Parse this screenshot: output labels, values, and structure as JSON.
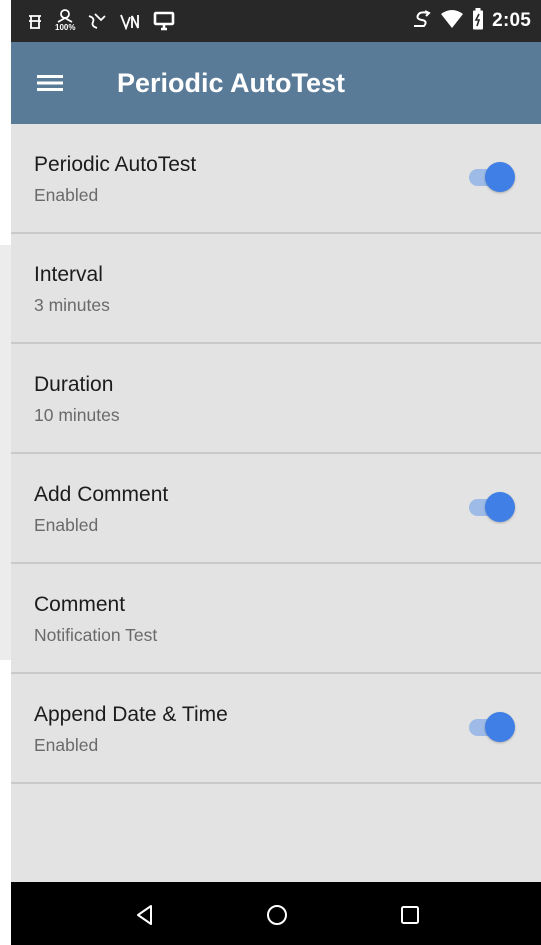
{
  "status_bar": {
    "time": "2:05",
    "icons_left": [
      "network-tool-icon",
      "battery-100-percent-icon",
      "signal-tool-icon",
      "voltage-icon",
      "desktop-icon"
    ],
    "icons_right": [
      "sync-arrow-icon",
      "wifi-icon",
      "battery-icon"
    ],
    "battery_small_label": "100%"
  },
  "app_bar": {
    "title": "Periodic AutoTest",
    "menu_icon": "hamburger-menu-icon",
    "background": "#5a7b98"
  },
  "settings": [
    {
      "title": "Periodic AutoTest",
      "subtitle": "Enabled",
      "toggle": true
    },
    {
      "title": "Interval",
      "subtitle": "3 minutes",
      "toggle": null
    },
    {
      "title": "Duration",
      "subtitle": "10 minutes",
      "toggle": null
    },
    {
      "title": "Add Comment",
      "subtitle": "Enabled",
      "toggle": true
    },
    {
      "title": "Comment",
      "subtitle": "Notification Test",
      "toggle": null
    },
    {
      "title": "Append Date & Time",
      "subtitle": "Enabled",
      "toggle": true
    }
  ],
  "nav_bar": {
    "buttons": [
      "back-icon",
      "home-icon",
      "recent-apps-icon"
    ]
  },
  "colors": {
    "accent": "#3f7fe6",
    "toggle_track": "#9dbbe6",
    "list_background": "#e3e3e3",
    "status_bar": "#282828"
  }
}
